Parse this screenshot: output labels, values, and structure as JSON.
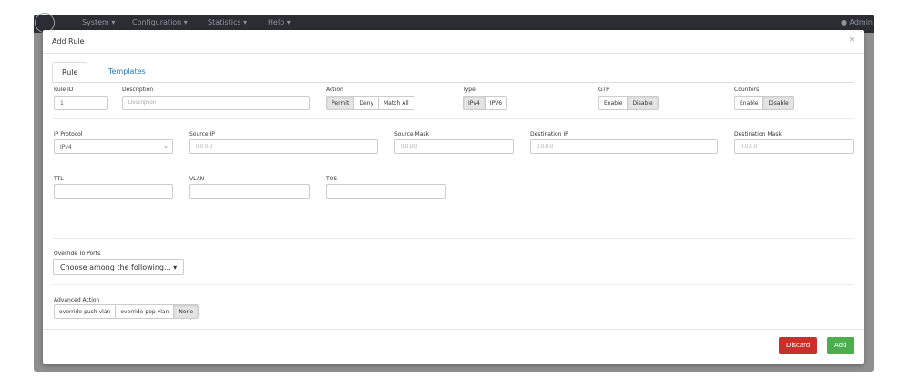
{
  "navbar": {
    "items": [
      "System ▾",
      "Configuration ▾",
      "Statistics ▾",
      "Help ▾"
    ],
    "user": "Admin"
  },
  "modal": {
    "title": "Add Rule",
    "close": "×",
    "tabs": [
      "Rule",
      "Templates"
    ]
  },
  "row1": {
    "rule_id_label": "Rule ID",
    "rule_id_value": "1",
    "description_label": "Description",
    "description_placeholder": "Description",
    "action_label": "Action",
    "action_options": [
      "Permit",
      "Deny",
      "Match All"
    ],
    "action_selected": "Permit",
    "type_label": "Type",
    "type_options": [
      "IPv4",
      "IPV6"
    ],
    "type_selected": "IPv4",
    "gtp_label": "GTP",
    "gtp_options": [
      "Enable",
      "Disable"
    ],
    "gtp_selected": "Disable",
    "counters_label": "Counters",
    "counters_options": [
      "Enable",
      "Disable"
    ],
    "counters_selected": "Disable"
  },
  "row2": {
    "ip_protocol_label": "IP Protocol",
    "ip_protocol_value": "IPv4",
    "source_ip_label": "Source IP",
    "source_ip_placeholder": "0.0.0.0",
    "source_mask_label": "Source Mask",
    "source_mask_placeholder": "0.0.0.0",
    "destination_ip_label": "Destination IP",
    "destination_ip_placeholder": "0.0.0.0",
    "destination_mask_label": "Destination Mask",
    "destination_mask_placeholder": "0.0.0.0"
  },
  "row3": {
    "ttl_label": "TTL",
    "vlan_label": "VLAN",
    "tos_label": "TOS"
  },
  "override": {
    "label": "Override To Ports",
    "dropdown": "Choose among the following... ▾"
  },
  "advanced": {
    "label": "Advanced Action",
    "options": [
      "override-push-vlan",
      "override-pop-vlan",
      "None"
    ],
    "selected": "None"
  },
  "footer": {
    "discard": "Discard",
    "add": "Add"
  },
  "colors": {
    "link": "#2a7ab8",
    "discard": "#c9302c",
    "add": "#4cae4c",
    "navbar": "#2b2d33"
  }
}
